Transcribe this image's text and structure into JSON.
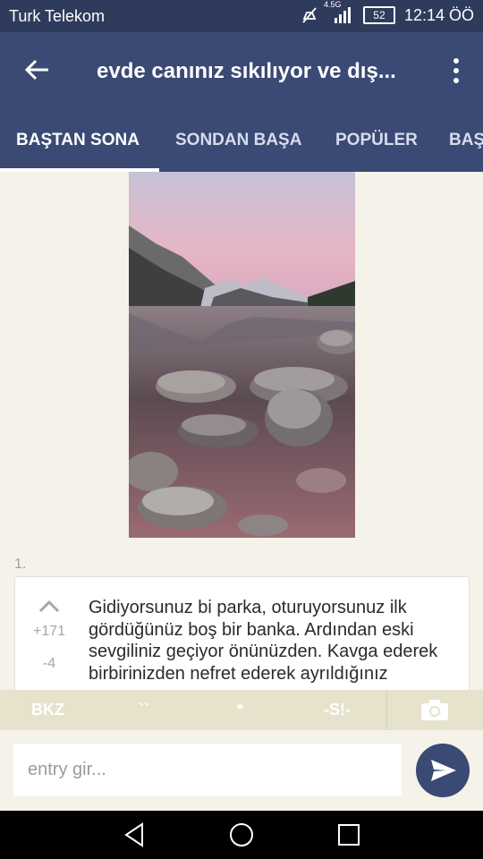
{
  "status_bar": {
    "carrier": "Turk Telekom",
    "network": "4.5G",
    "battery": "52",
    "time": "12:14 ÖÖ"
  },
  "app_bar": {
    "title": "evde canınız sıkılıyor ve dış..."
  },
  "tabs": [
    {
      "label": "BAŞTAN SONA"
    },
    {
      "label": "SONDAN BAŞA"
    },
    {
      "label": "POPÜLER"
    },
    {
      "label": "BAŞ"
    }
  ],
  "entry": {
    "number": "1.",
    "upvotes": "+171",
    "downvotes": "-4",
    "text": "Gidiyorsunuz bi parka, oturuyorsunuz ilk gördüğünüz boş bir banka. Ardından eski sevgiliniz geçiyor önünüzden. Kavga ederek birbirinizden nefret ederek ayrıldığınız"
  },
  "format_toolbar": {
    "bkz": "BKZ",
    "backticks": "``",
    "star": "*",
    "spoiler": "-S!-"
  },
  "composer": {
    "placeholder": "entry gir..."
  },
  "colors": {
    "primary": "#3a4a74",
    "status_bar": "#2f3b5c",
    "background": "#f4f2e9",
    "toolbar": "#e6e2cc"
  }
}
